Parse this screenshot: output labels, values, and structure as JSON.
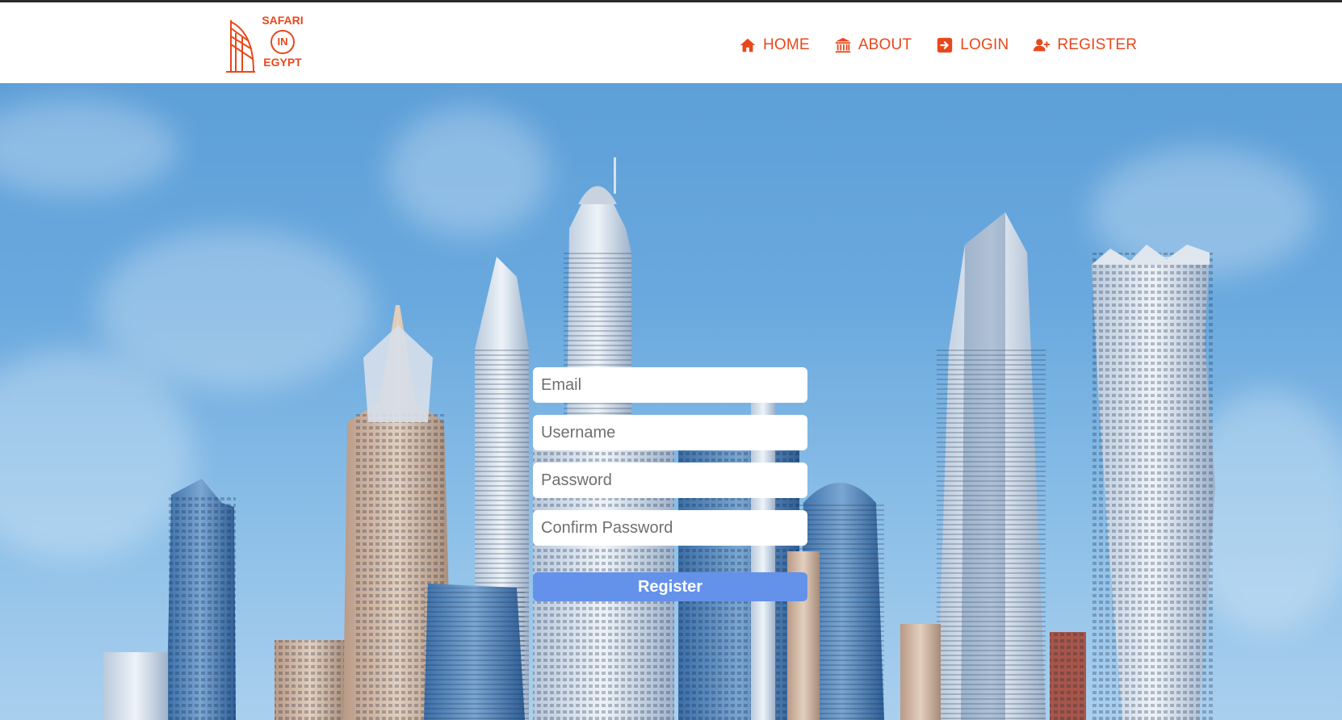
{
  "brand": {
    "line1": "SAFARI",
    "line2": "IN",
    "line3": "EGYPT",
    "logo_icon": "burj-al-arab-icon",
    "accent_color": "#e8481c"
  },
  "nav": {
    "items": [
      {
        "label": "HOME",
        "icon": "home-icon"
      },
      {
        "label": "ABOUT",
        "icon": "museum-icon"
      },
      {
        "label": "LOGIN",
        "icon": "login-icon"
      },
      {
        "label": "REGISTER",
        "icon": "user-plus-icon"
      }
    ]
  },
  "form": {
    "email_placeholder": "Email",
    "username_placeholder": "Username",
    "password_placeholder": "Password",
    "confirm_placeholder": "Confirm Password",
    "submit_label": "Register",
    "button_color": "#6492ea"
  }
}
